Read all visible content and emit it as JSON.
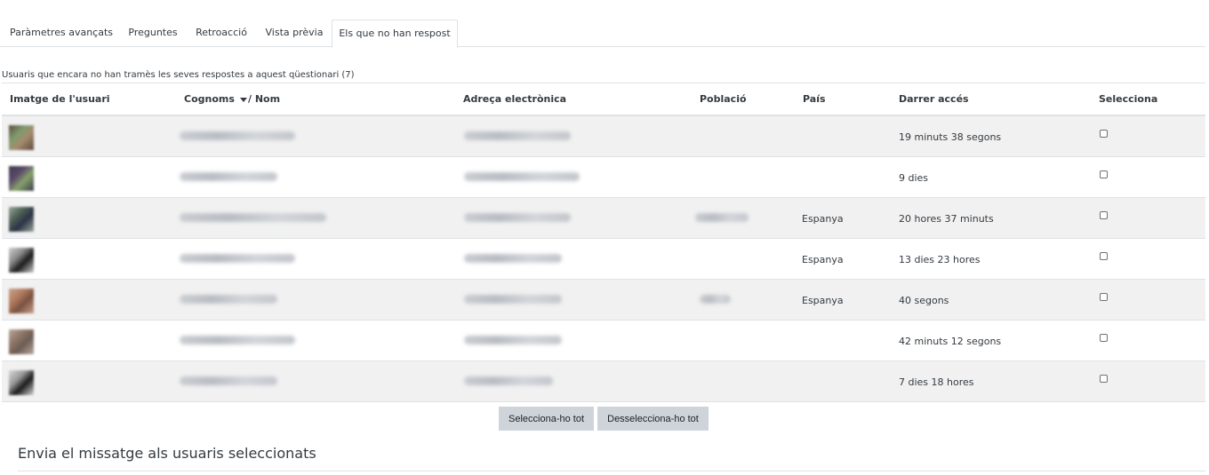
{
  "tabs": [
    {
      "label": "Paràmetres avançats",
      "active": false
    },
    {
      "label": "Preguntes",
      "active": false
    },
    {
      "label": "Retroacció",
      "active": false
    },
    {
      "label": "Vista prèvia",
      "active": false
    },
    {
      "label": "Els que no han respost",
      "active": true
    }
  ],
  "caption": "Usuaris que encara no han tramès les seves respostes a aquest qüestionari (7)",
  "table": {
    "headers": {
      "image": "Imatge de l'usuari",
      "surname": "Cognoms",
      "name": "/ Nom",
      "email": "Adreça electrònica",
      "city": "Població",
      "country": "País",
      "last_access": "Darrer accés",
      "select": "Selecciona"
    },
    "rows": [
      {
        "country": "",
        "last_access": "19 minuts 38 segons",
        "avatar_colors": [
          "#7f9b6e",
          "#a58a6c",
          "#5b4a3e"
        ]
      },
      {
        "country": "",
        "last_access": "9 dies",
        "avatar_colors": [
          "#5b4a6a",
          "#86a16b",
          "#3c3b4c"
        ]
      },
      {
        "country": "Espanya",
        "last_access": "20 hores 37 minuts",
        "avatar_colors": [
          "#4d5f54",
          "#2b3346",
          "#9ca69a"
        ]
      },
      {
        "country": "Espanya",
        "last_access": "13 dies 23 hores",
        "avatar_colors": [
          "#8a8a8a",
          "#1c1c1c",
          "#cfcfcf"
        ]
      },
      {
        "country": "Espanya",
        "last_access": "40 segons",
        "avatar_colors": [
          "#b07b5e",
          "#7a5242",
          "#caa08c"
        ]
      },
      {
        "country": "",
        "last_access": "42 minuts 12 segons",
        "avatar_colors": [
          "#8e7668",
          "#6c5c55",
          "#b9a89b"
        ]
      },
      {
        "country": "",
        "last_access": "7 dies 18 hores",
        "avatar_colors": [
          "#9a9a9a",
          "#1b1b1b",
          "#d8d8d8"
        ]
      }
    ]
  },
  "buttons": {
    "select_all": "Selecciona-ho tot",
    "deselect_all": "Desselecciona-ho tot"
  },
  "section_title": "Envia el missatge als usuaris seleccionats"
}
